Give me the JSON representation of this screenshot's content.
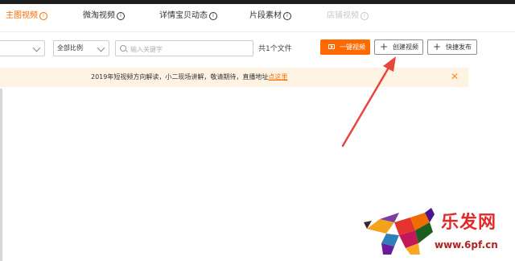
{
  "tabs": [
    {
      "label": "主图视频",
      "state": "active",
      "has_info": true
    },
    {
      "label": "微淘视频",
      "state": "normal",
      "has_info": true
    },
    {
      "label": "详情宝贝动态",
      "state": "normal",
      "has_info": true
    },
    {
      "label": "片段素材",
      "state": "normal",
      "has_info": true
    },
    {
      "label": "店铺视频",
      "state": "disabled",
      "has_info": true
    }
  ],
  "info_glyph": "i",
  "filters": {
    "first_select_value": "",
    "ratio_select_value": "全部比例",
    "search_placeholder": "输入关键字",
    "search_value": "",
    "file_count": "共1个文件"
  },
  "actions": {
    "one_click_label": "一键视频",
    "create_label": "创建视频",
    "publish_label": "快捷发布",
    "plus_glyph": "+"
  },
  "notice": {
    "message": "2019年短视频方向解读，小二现场讲解，敬请期待，直播地址",
    "link_text": "点这里",
    "close_glyph": "✕"
  },
  "watermark": {
    "title": "乐发网",
    "url": "www.6pf.cn"
  },
  "colors": {
    "accent": "#ff6a00",
    "notice_bg": "#fff3e3",
    "annotation_arrow": "#e8453c",
    "topbar": "#1e1e1e",
    "watermark_red": "#e12b2b"
  },
  "icons": {
    "info": "info-circle-icon",
    "dropdown": "chevron-down-icon",
    "search": "search-icon",
    "video": "video-play-icon",
    "plus": "plus-icon",
    "close": "close-icon"
  }
}
